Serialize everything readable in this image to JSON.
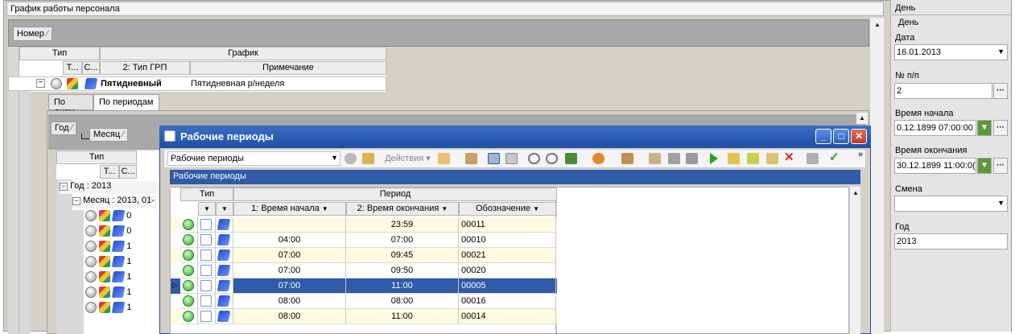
{
  "main": {
    "title": "График работы персонала",
    "group_by": "Номер",
    "table": {
      "header_left": "Тип",
      "header_right": "График",
      "sub_cols": [
        "Т...",
        "С...",
        "2: Тип ГРП",
        "Примечание"
      ],
      "row": {
        "name": "Пятидневный",
        "note": "Пятидневная р/неделя"
      }
    },
    "tabs": [
      "По дням",
      "По периодам"
    ],
    "periods_panel": {
      "group_year": "Год",
      "group_month": "Месяц",
      "col_type": "Тип",
      "sub_cols": [
        "Т...",
        "С..."
      ],
      "year_row": "Год : 2013",
      "month_row": "Месяц : 2013, 01-",
      "row_values": [
        "0",
        "0",
        "1",
        "1",
        "1",
        "1",
        "1"
      ]
    }
  },
  "dialog": {
    "title": "Рабочие периоды",
    "combo": "Рабочие периоды",
    "actions_label": "Действия",
    "subheader": "Рабочие периоды",
    "grid": {
      "group_type": "Тип",
      "group_period": "Период",
      "columns": [
        "1: Время начала",
        "2: Время окончания",
        "Обозначение"
      ],
      "rows": [
        {
          "start": "",
          "end": "23:59",
          "code": "00011",
          "selected": false
        },
        {
          "start": "04:00",
          "end": "07:00",
          "code": "00010",
          "selected": false
        },
        {
          "start": "07:00",
          "end": "09:45",
          "code": "00021",
          "selected": false
        },
        {
          "start": "07:00",
          "end": "09:50",
          "code": "00020",
          "selected": false
        },
        {
          "start": "07:00",
          "end": "11:00",
          "code": "00005",
          "selected": true
        },
        {
          "start": "08:00",
          "end": "08:00",
          "code": "00016",
          "selected": false
        },
        {
          "start": "08:00",
          "end": "11:00",
          "code": "00014",
          "selected": false
        }
      ]
    }
  },
  "right_panel": {
    "header": "День",
    "group_label": "День",
    "date_label": "Дата",
    "date_value": "16.01.2013",
    "num_label": "№ п/п",
    "num_value": "2",
    "start_label": "Время начала",
    "start_value": "0.12.1899 07:00:00",
    "end_label": "Время окончания",
    "end_value": "30.12.1899 11:00:0(",
    "shift_label": "Смена",
    "shift_value": "",
    "year_label": "Год",
    "year_value": "2013"
  },
  "colors": {
    "selection": "#2f5ba8",
    "title_bar": "#2a5bb8",
    "row_yellow": "#fffbe0",
    "close": "#d8412f"
  }
}
